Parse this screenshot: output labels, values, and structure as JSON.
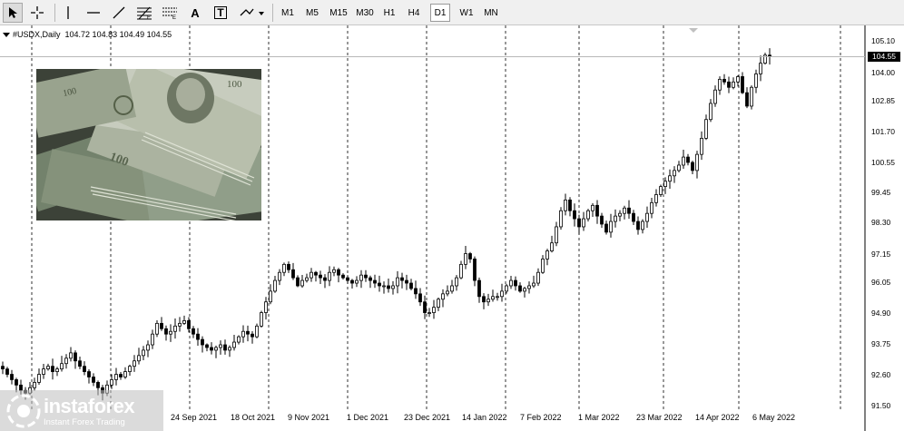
{
  "toolbar": {
    "tools": [
      {
        "name": "cursor-icon",
        "selected": true
      },
      {
        "name": "crosshair-icon",
        "selected": false
      },
      {
        "name": "vertical-line-icon",
        "selected": false
      },
      {
        "name": "horizontal-line-icon",
        "selected": false
      },
      {
        "name": "trendline-icon",
        "selected": false
      },
      {
        "name": "fibonacci-icon",
        "selected": false
      },
      {
        "name": "fibonacci-expansion-icon",
        "selected": false
      },
      {
        "name": "text-icon",
        "selected": false
      },
      {
        "name": "text-label-icon",
        "selected": false
      },
      {
        "name": "shapes-dropdown-icon",
        "selected": false
      }
    ],
    "text_tool_glyph": "A",
    "text_label_glyph": "T",
    "timeframes": [
      {
        "label": "M1",
        "active": false
      },
      {
        "label": "M5",
        "active": false
      },
      {
        "label": "M15",
        "active": false
      },
      {
        "label": "M30",
        "active": false
      },
      {
        "label": "H1",
        "active": false
      },
      {
        "label": "H4",
        "active": false
      },
      {
        "label": "D1",
        "active": true
      },
      {
        "label": "W1",
        "active": false
      },
      {
        "label": "MN",
        "active": false
      }
    ]
  },
  "chart_header": {
    "symbol": "#USDX,Daily",
    "ohlc": "104.72 104.83 104.49 104.55"
  },
  "price_axis": {
    "labels": [
      "105.10",
      "104.00",
      "102.85",
      "101.70",
      "100.55",
      "99.45",
      "98.30",
      "97.15",
      "96.05",
      "94.90",
      "93.75",
      "92.60",
      "91.50"
    ],
    "current_price": "104.55"
  },
  "date_axis": {
    "labels": [
      "24 Sep 2021",
      "18 Oct 2021",
      "9 Nov 2021",
      "1 Dec 2021",
      "23 Dec 2021",
      "14 Jan 2022",
      "7 Feb 2022",
      "1 Mar 2022",
      "23 Mar 2022",
      "14 Apr 2022",
      "6 May 2022"
    ]
  },
  "watermark": {
    "brand": "instaforex",
    "tagline": "Instant Forex Trading"
  },
  "colors": {
    "bull": "#ffffff",
    "bear": "#000000",
    "grid": "#000000",
    "background": "#ffffff",
    "toolbar_bg": "#f0f0f0"
  },
  "chart_data": {
    "type": "candlestick",
    "title": "#USDX,Daily",
    "xlabel": "",
    "ylabel": "",
    "ylim": [
      91.4,
      105.3
    ],
    "grid": true,
    "x_ticks": [
      "24 Sep 2021",
      "18 Oct 2021",
      "9 Nov 2021",
      "1 Dec 2021",
      "23 Dec 2021",
      "14 Jan 2022",
      "7 Feb 2022",
      "1 Mar 2022",
      "23 Mar 2022",
      "14 Apr 2022",
      "6 May 2022"
    ],
    "y_ticks": [
      105.1,
      104.0,
      102.85,
      101.7,
      100.55,
      99.45,
      98.3,
      97.15,
      96.05,
      94.9,
      93.75,
      92.6,
      91.5
    ],
    "close_path": [
      92.9,
      92.7,
      92.5,
      92.3,
      92.1,
      92.0,
      92.2,
      92.4,
      92.7,
      92.9,
      93.0,
      92.8,
      92.9,
      93.1,
      93.3,
      93.5,
      93.2,
      93.0,
      92.8,
      92.6,
      92.4,
      92.2,
      92.0,
      92.3,
      92.5,
      92.7,
      92.6,
      92.8,
      93.0,
      93.2,
      93.4,
      93.6,
      93.8,
      94.2,
      94.6,
      94.4,
      94.2,
      94.3,
      94.5,
      94.6,
      94.7,
      94.4,
      94.2,
      94.0,
      93.8,
      93.7,
      93.6,
      93.7,
      93.8,
      93.6,
      93.7,
      93.9,
      94.1,
      94.3,
      94.2,
      94.1,
      94.5,
      95.0,
      95.4,
      95.8,
      96.2,
      96.5,
      96.8,
      96.6,
      96.3,
      96.0,
      96.2,
      96.3,
      96.5,
      96.4,
      96.3,
      96.2,
      96.5,
      96.6,
      96.4,
      96.3,
      96.2,
      96.1,
      96.2,
      96.4,
      96.3,
      96.2,
      96.1,
      96.0,
      96.0,
      95.9,
      96.0,
      96.3,
      96.2,
      96.1,
      95.9,
      95.7,
      95.4,
      95.0,
      95.0,
      95.2,
      95.5,
      95.7,
      95.8,
      96.0,
      96.3,
      96.8,
      97.2,
      97.0,
      96.2,
      95.6,
      95.4,
      95.5,
      95.6,
      95.6,
      95.8,
      96.0,
      96.2,
      96.0,
      95.8,
      95.9,
      96.0,
      96.1,
      96.5,
      97.0,
      97.3,
      97.6,
      98.2,
      98.8,
      99.2,
      98.8,
      98.5,
      98.2,
      98.5,
      98.8,
      99.0,
      98.6,
      98.3,
      98.0,
      98.4,
      98.6,
      98.7,
      98.9,
      98.7,
      98.4,
      98.1,
      98.4,
      98.7,
      99.1,
      99.4,
      99.7,
      99.9,
      100.1,
      100.3,
      100.5,
      100.8,
      100.6,
      100.3,
      100.9,
      101.5,
      102.2,
      102.8,
      103.3,
      103.7,
      103.6,
      103.4,
      103.6,
      103.8,
      103.2,
      102.7,
      103.4,
      103.9,
      104.3,
      104.6,
      104.55
    ]
  }
}
